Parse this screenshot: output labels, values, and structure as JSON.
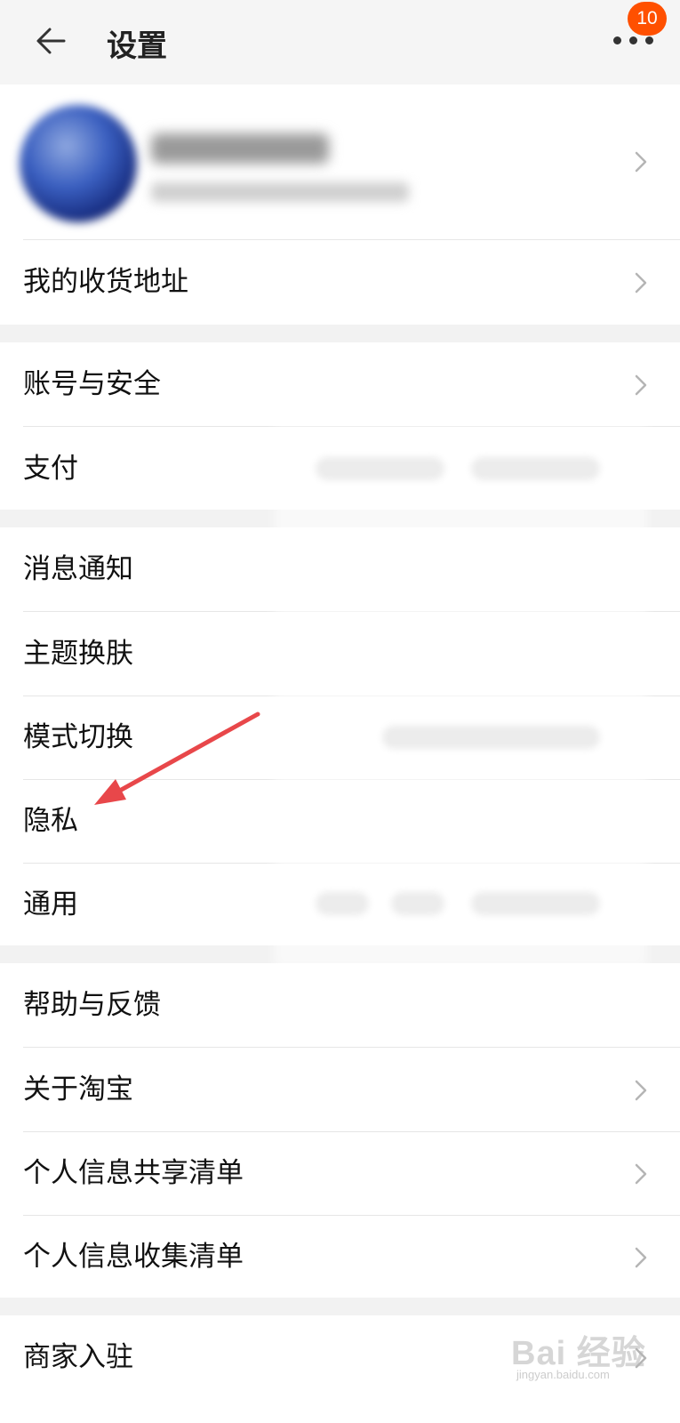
{
  "header": {
    "title": "设置",
    "back_icon": "arrow-left-icon",
    "more_icon": "more-dots-icon",
    "badge_count": "10",
    "badge_color": "#ff5000"
  },
  "profile": {
    "avatar_icon": "avatar-blurred"
  },
  "sections": [
    {
      "items": [
        {
          "label": "我的收货地址"
        }
      ]
    },
    {
      "items": [
        {
          "label": "账号与安全"
        },
        {
          "label": "支付"
        }
      ]
    },
    {
      "items": [
        {
          "label": "消息通知"
        },
        {
          "label": "主题换肤"
        },
        {
          "label": "模式切换"
        },
        {
          "label": "隐私"
        },
        {
          "label": "通用"
        }
      ]
    },
    {
      "items": [
        {
          "label": "帮助与反馈"
        },
        {
          "label": "关于淘宝"
        },
        {
          "label": "个人信息共享清单"
        },
        {
          "label": "个人信息收集清单"
        }
      ]
    },
    {
      "items": [
        {
          "label": "商家入驻"
        }
      ]
    }
  ],
  "annotation": {
    "arrow_color": "#e8474a"
  },
  "watermark": {
    "main": "Bai 经验",
    "sub": "jingyan.baidu.com"
  }
}
